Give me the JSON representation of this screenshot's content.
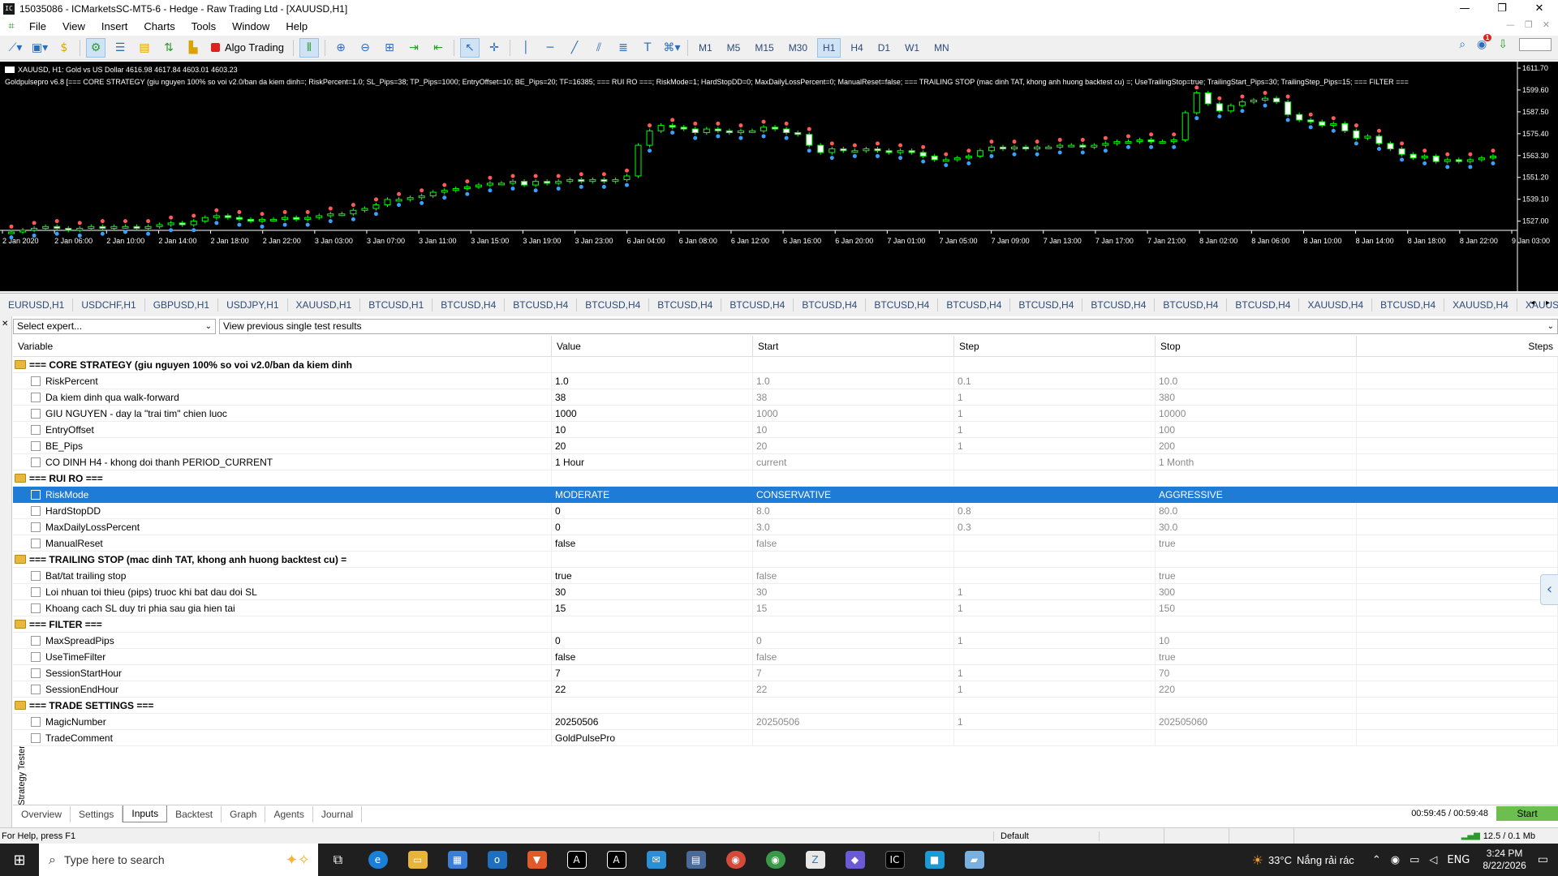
{
  "window": {
    "title": "15035086 - ICMarketsSC-MT5-6 - Hedge - Raw Trading Ltd - [XAUUSD,H1]",
    "controls": [
      "—",
      "❐",
      "✕"
    ]
  },
  "menu": {
    "items": [
      "File",
      "View",
      "Insert",
      "Charts",
      "Tools",
      "Window",
      "Help"
    ]
  },
  "toolbar": {
    "algo_trading": "Algo Trading",
    "timeframes": [
      "M1",
      "M5",
      "M15",
      "M30",
      "H1",
      "H4",
      "D1",
      "W1",
      "MN"
    ],
    "active_timeframe": "H1",
    "notification_count": "1"
  },
  "chart": {
    "symbol_line": "XAUUSD, H1:  Gold vs US Dollar  4616.98 4617.84 4603.01 4603.23",
    "ea_line": "Goldpulsepro v6.8 [=== CORE STRATEGY (giu nguyen 100% so voi v2.0/ban da kiem dinh=; RiskPercent=1.0; SL_Pips=38; TP_Pips=1000; EntryOffset=10; BE_Pips=20; TF=16385; === RUI RO ===; RiskMode=1; HardStopDD=0; MaxDailyLossPercent=0; ManualReset=false; === TRAILING STOP (mac dinh TAT, khong anh huong backtest cu) =; UseTrailingStop=true; TrailingStart_Pips=30; TrailingStep_Pips=15; === FILTER ===",
    "price_ticks": [
      "1611.70",
      "1599.60",
      "1587.50",
      "1575.40",
      "1563.30",
      "1551.20",
      "1539.10",
      "1527.00"
    ],
    "time_ticks": [
      "2 Jan 2020",
      "2 Jan 06:00",
      "2 Jan 10:00",
      "2 Jan 14:00",
      "2 Jan 18:00",
      "2 Jan 22:00",
      "3 Jan 03:00",
      "3 Jan 07:00",
      "3 Jan 11:00",
      "3 Jan 15:00",
      "3 Jan 19:00",
      "3 Jan 23:00",
      "6 Jan 04:00",
      "6 Jan 08:00",
      "6 Jan 12:00",
      "6 Jan 16:00",
      "6 Jan 20:00",
      "7 Jan 01:00",
      "7 Jan 05:00",
      "7 Jan 09:00",
      "7 Jan 13:00",
      "7 Jan 17:00",
      "7 Jan 21:00",
      "8 Jan 02:00",
      "8 Jan 06:00",
      "8 Jan 10:00",
      "8 Jan 14:00",
      "8 Jan 18:00",
      "8 Jan 22:00",
      "9 Jan 03:00"
    ],
    "candles": [
      1521,
      1522,
      1523,
      1524,
      1523,
      1522,
      1523,
      1524,
      1523,
      1524,
      1524,
      1523,
      1524,
      1525,
      1526,
      1525,
      1527,
      1529,
      1530,
      1529,
      1528,
      1527,
      1528,
      1528,
      1529,
      1528,
      1529,
      1530,
      1531,
      1531,
      1533,
      1534,
      1536,
      1539,
      1539,
      1540,
      1541,
      1543,
      1544,
      1545,
      1546,
      1547,
      1548,
      1548,
      1549,
      1547,
      1549,
      1548,
      1549,
      1550,
      1549,
      1550,
      1549,
      1550,
      1552,
      1569,
      1577,
      1580,
      1579,
      1578,
      1576,
      1578,
      1577,
      1576,
      1577,
      1577,
      1579,
      1578,
      1576,
      1575,
      1569,
      1565,
      1567,
      1566,
      1566,
      1567,
      1566,
      1565,
      1566,
      1565,
      1563,
      1561,
      1561,
      1562,
      1563,
      1566,
      1568,
      1567,
      1568,
      1567,
      1568,
      1568,
      1569,
      1569,
      1568,
      1569,
      1570,
      1571,
      1571,
      1572,
      1571,
      1571,
      1572,
      1587,
      1598,
      1592,
      1588,
      1591,
      1593,
      1594,
      1595,
      1593,
      1586,
      1583,
      1582,
      1580,
      1581,
      1577,
      1573,
      1574,
      1570,
      1567,
      1564,
      1562,
      1563,
      1560,
      1561,
      1560,
      1561,
      1562,
      1563
    ]
  },
  "chart_tabs": [
    "EURUSD,H1",
    "USDCHF,H1",
    "GBPUSD,H1",
    "USDJPY,H1",
    "XAUUSD,H1",
    "BTCUSD,H1",
    "BTCUSD,H4",
    "BTCUSD,H4",
    "BTCUSD,H4",
    "BTCUSD,H4",
    "BTCUSD,H4",
    "BTCUSD,H4",
    "BTCUSD,H4",
    "BTCUSD,H4",
    "BTCUSD,H4",
    "BTCUSD,H4",
    "BTCUSD,H4",
    "BTCUSD,H4",
    "XAUUSD,H4",
    "BTCUSD,H4",
    "XAUUSD,H4",
    "XAUUSD,H4"
  ],
  "tester": {
    "select_expert": "Select expert...",
    "view_previous": "View previous single test results",
    "columns": [
      "Variable",
      "Value",
      "Start",
      "Step",
      "Stop",
      "Steps"
    ],
    "rows": [
      {
        "type": "group",
        "name": "=== CORE STRATEGY (giu nguyen 100% so voi v2.0/ban da kiem dinh"
      },
      {
        "type": "item",
        "name": "RiskPercent",
        "value": "1.0",
        "start": "1.0",
        "step": "0.1",
        "stop": "10.0"
      },
      {
        "type": "item",
        "name": "Da kiem dinh qua walk-forward",
        "value": "38",
        "start": "38",
        "step": "1",
        "stop": "380"
      },
      {
        "type": "item",
        "name": "GIU NGUYEN - day la \"trai tim\" chien luoc",
        "value": "1000",
        "start": "1000",
        "step": "1",
        "stop": "10000"
      },
      {
        "type": "item",
        "name": "EntryOffset",
        "value": "10",
        "start": "10",
        "step": "1",
        "stop": "100"
      },
      {
        "type": "item",
        "name": "BE_Pips",
        "value": "20",
        "start": "20",
        "step": "1",
        "stop": "200"
      },
      {
        "type": "item",
        "name": "CO DINH H4 - khong doi thanh PERIOD_CURRENT",
        "value": "1 Hour",
        "start": "current",
        "step": "",
        "stop": "1 Month"
      },
      {
        "type": "group",
        "name": "=== RUI RO ==="
      },
      {
        "type": "item",
        "name": "RiskMode",
        "value": "MODERATE",
        "start": "CONSERVATIVE",
        "step": "",
        "stop": "AGGRESSIVE",
        "selected": true
      },
      {
        "type": "item",
        "name": "HardStopDD",
        "value": "0",
        "start": "8.0",
        "step": "0.8",
        "stop": "80.0"
      },
      {
        "type": "item",
        "name": "MaxDailyLossPercent",
        "value": "0",
        "start": "3.0",
        "step": "0.3",
        "stop": "30.0"
      },
      {
        "type": "item",
        "name": "ManualReset",
        "value": "false",
        "start": "false",
        "step": "",
        "stop": "true"
      },
      {
        "type": "group",
        "name": "=== TRAILING STOP (mac dinh TAT, khong anh huong backtest cu) ="
      },
      {
        "type": "item",
        "name": "Bat/tat trailing stop",
        "value": "true",
        "start": "false",
        "step": "",
        "stop": "true"
      },
      {
        "type": "item",
        "name": "Loi nhuan toi thieu (pips) truoc khi bat dau doi SL",
        "value": "30",
        "start": "30",
        "step": "1",
        "stop": "300"
      },
      {
        "type": "item",
        "name": "Khoang cach SL duy tri phia sau gia hien tai",
        "value": "15",
        "start": "15",
        "step": "1",
        "stop": "150"
      },
      {
        "type": "group",
        "name": "=== FILTER ==="
      },
      {
        "type": "item",
        "name": "MaxSpreadPips",
        "value": "0",
        "start": "0",
        "step": "1",
        "stop": "10"
      },
      {
        "type": "item",
        "name": "UseTimeFilter",
        "value": "false",
        "start": "false",
        "step": "",
        "stop": "true"
      },
      {
        "type": "item",
        "name": "SessionStartHour",
        "value": "7",
        "start": "7",
        "step": "1",
        "stop": "70"
      },
      {
        "type": "item",
        "name": "SessionEndHour",
        "value": "22",
        "start": "22",
        "step": "1",
        "stop": "220"
      },
      {
        "type": "group",
        "name": "=== TRADE SETTINGS ==="
      },
      {
        "type": "item",
        "name": "MagicNumber",
        "value": "20250506",
        "start": "20250506",
        "step": "1",
        "stop": "202505060"
      },
      {
        "type": "item",
        "name": "TradeComment",
        "value": "GoldPulsePro",
        "start": "",
        "step": "",
        "stop": ""
      }
    ],
    "bottom_tabs": [
      "Overview",
      "Settings",
      "Inputs",
      "Backtest",
      "Graph",
      "Agents",
      "Journal"
    ],
    "active_tab": "Inputs",
    "side_label": "Strategy Tester",
    "timer": "00:59:45 / 00:59:48",
    "start_button": "Start"
  },
  "statusbar": {
    "help": "For Help, press F1",
    "profile": "Default",
    "network": "12.5 / 0.1 Mb"
  },
  "taskbar": {
    "search_placeholder": "Type here to search",
    "weather_temp": "33°C",
    "weather_text": "Nắng rải rác",
    "lang": "ENG",
    "time": "3:24 PM",
    "date": "8/22/2026"
  }
}
